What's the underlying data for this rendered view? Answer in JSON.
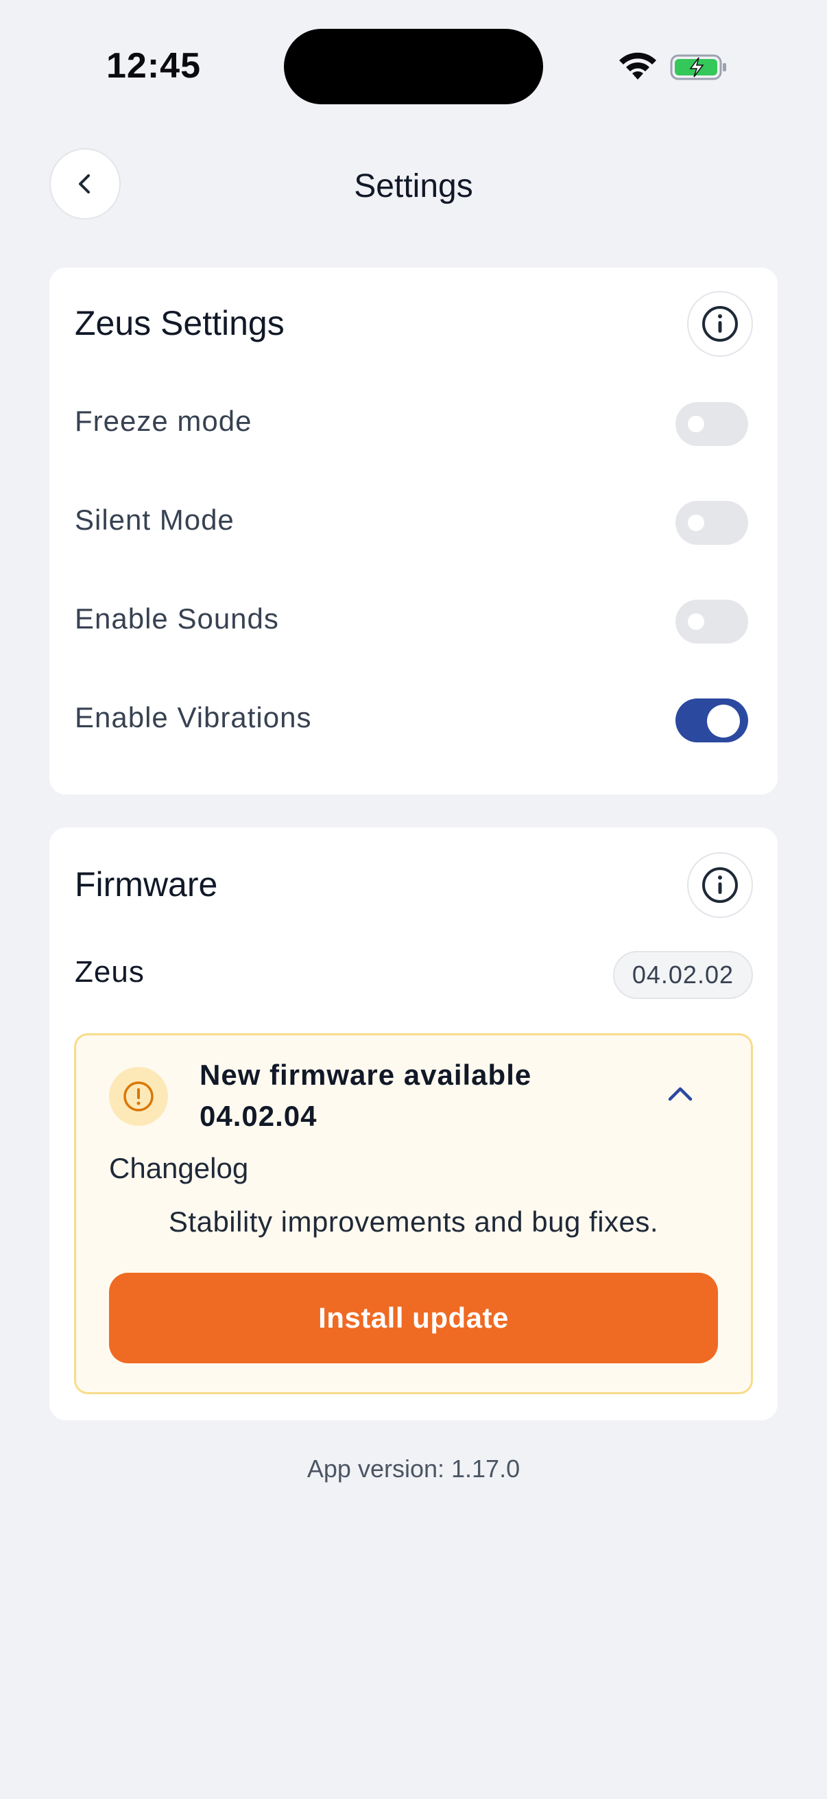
{
  "status_bar": {
    "time": "12:45",
    "battery_color": "#34c759"
  },
  "nav": {
    "title": "Settings",
    "back_icon": "chevron-left-icon"
  },
  "zeus_settings": {
    "title": "Zeus Settings",
    "info_icon": "info-icon",
    "toggles": [
      {
        "label": "Freeze mode",
        "on": false
      },
      {
        "label": "Silent Mode",
        "on": false
      },
      {
        "label": "Enable Sounds",
        "on": false
      },
      {
        "label": "Enable Vibrations",
        "on": true
      }
    ]
  },
  "firmware": {
    "title": "Firmware",
    "info_icon": "info-icon",
    "device_name": "Zeus",
    "current_version": "04.02.02",
    "update": {
      "title_line1": "New firmware available",
      "title_line2": "04.02.04",
      "changelog_label": "Changelog",
      "changelog_text": "Stability improvements and bug fixes.",
      "install_label": "Install update",
      "accent_color": "#ef6a23",
      "icon": "alert-circle-icon",
      "expand_icon": "chevron-up-icon"
    }
  },
  "footer": {
    "app_version": "App version: 1.17.0"
  },
  "colors": {
    "toggle_on": "#2c49a0",
    "toggle_off": "#e5e6ea",
    "background": "#f1f2f6"
  }
}
